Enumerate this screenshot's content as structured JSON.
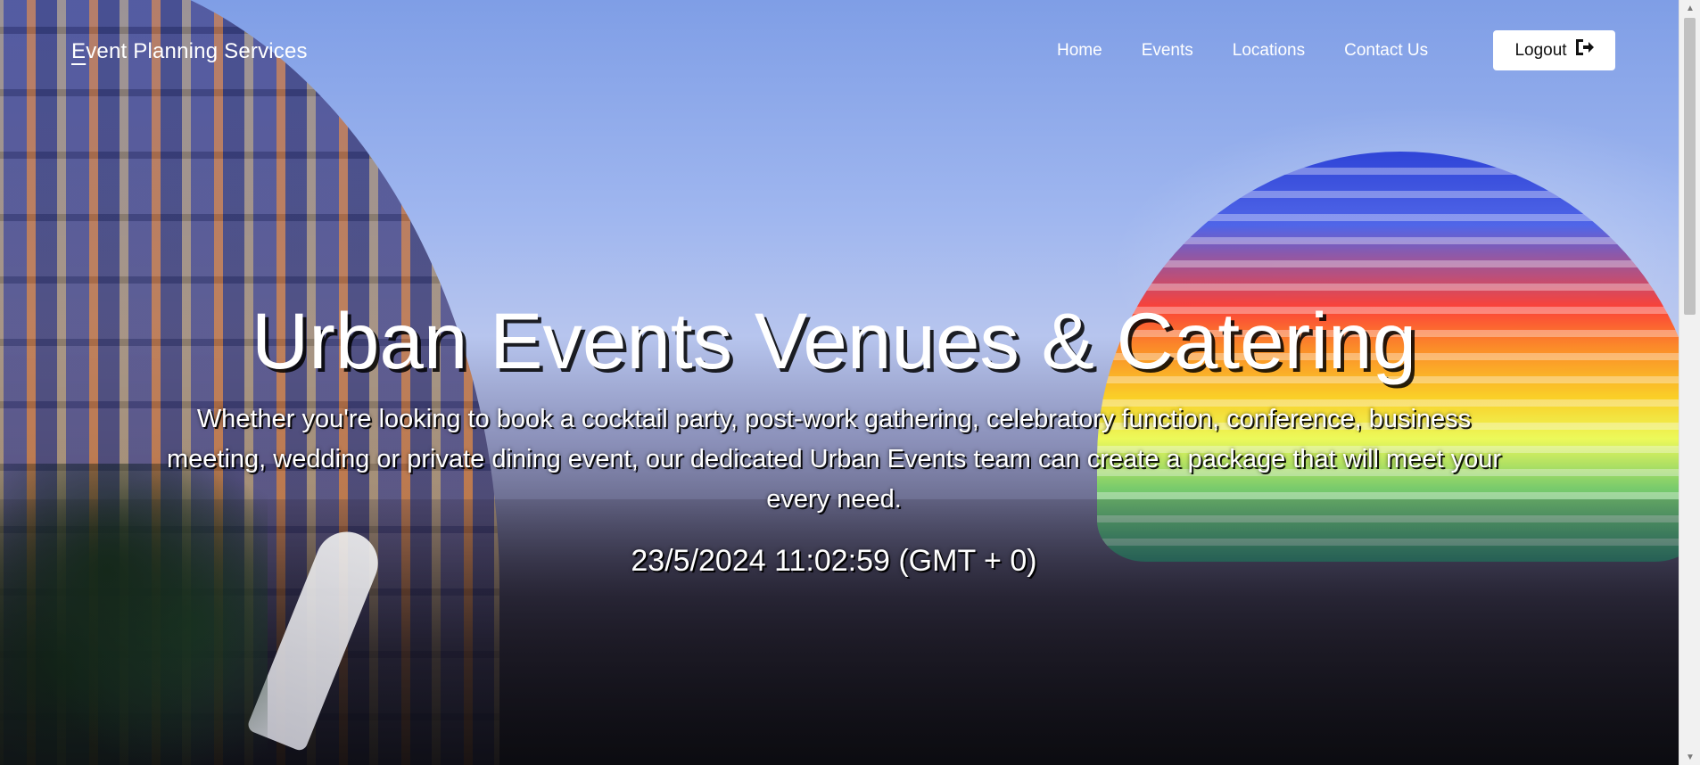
{
  "navbar": {
    "brand_first_letter": "E",
    "brand_rest": "vent Planning Services",
    "links": [
      {
        "label": "Home"
      },
      {
        "label": "Events"
      },
      {
        "label": "Locations"
      },
      {
        "label": "Contact Us"
      }
    ],
    "logout_label": "Logout",
    "logout_icon": "sign-out-icon"
  },
  "hero": {
    "title": "Urban Events Venues & Catering",
    "description": "Whether you're looking to book a cocktail party, post-work gathering, celebratory function, conference, business meeting, wedding or private dining event, our dedicated Urban Events team can create a package that will meet your every need.",
    "clock": "23/5/2024 11:02:59 (GMT + 0)"
  },
  "colors": {
    "nav_text": "#ffffff",
    "logout_bg": "#ffffff",
    "logout_text": "#111111",
    "hero_text": "#ffffff"
  },
  "scrollbar": {
    "up_icon": "scroll-up-arrow-icon",
    "down_icon": "scroll-down-arrow-icon"
  }
}
